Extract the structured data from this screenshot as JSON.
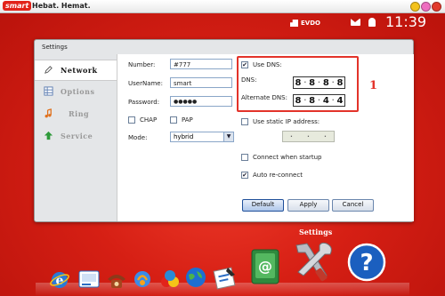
{
  "topbar": {
    "logo": "smart",
    "tagline": "Hebat. Hemat."
  },
  "status": {
    "network": "EVDO",
    "time": "11:39"
  },
  "dialog": {
    "title": "Settings",
    "sidebar": [
      {
        "label": "Network",
        "icon": "pencil-icon"
      },
      {
        "label": "Options",
        "icon": "options-grid-icon"
      },
      {
        "label": "Ring",
        "icon": "music-note-icon"
      },
      {
        "label": "Service",
        "icon": "up-arrow-icon"
      }
    ],
    "form": {
      "number_label": "Number:",
      "number_value": "#777",
      "username_label": "UserName:",
      "username_value": "smart",
      "password_label": "Password:",
      "password_value": "●●●●●",
      "chap_label": "CHAP",
      "pap_label": "PAP",
      "mode_label": "Mode:",
      "mode_value": "hybrid"
    },
    "dns": {
      "use_dns_label": "Use DNS:",
      "use_dns_checked": "✔",
      "dns_label": "DNS:",
      "dns_octets": [
        "8",
        "8",
        "8",
        "8"
      ],
      "alt_label": "Alternate DNS:",
      "alt_octets": [
        "8",
        "8",
        "4",
        "4"
      ],
      "callout": "1"
    },
    "static_ip_label": "Use static IP address:",
    "connect_startup_label": "Connect when startup",
    "auto_reconnect_label": "Auto re-connect",
    "auto_reconnect_checked": "✔",
    "buttons": {
      "default": "Default",
      "apply": "Apply",
      "cancel": "Cancel"
    }
  },
  "dock": {
    "title": "Settings",
    "icons": [
      "internet-explorer-icon",
      "sms-icon",
      "phone-icon",
      "messenger-icon",
      "paint-icon",
      "globe-icon",
      "notes-icon",
      "email-icon",
      "settings-tools-icon",
      "help-icon"
    ]
  },
  "colors": {
    "brand": "#e2231a",
    "highlight": "#e3332a"
  }
}
